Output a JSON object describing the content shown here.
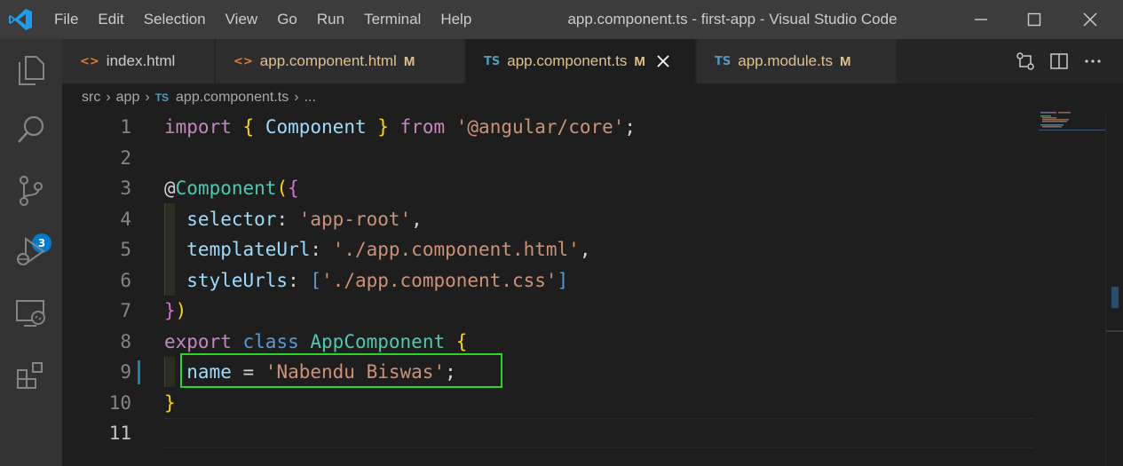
{
  "titlebar": {
    "menu": [
      "File",
      "Edit",
      "Selection",
      "View",
      "Go",
      "Run",
      "Terminal",
      "Help"
    ],
    "window_title": "app.component.ts - first-app - Visual Studio Code"
  },
  "activity_bar": {
    "items": [
      "explorer-icon",
      "search-icon",
      "source-control-icon",
      "run-debug-icon",
      "remote-explorer-icon",
      "extensions-icon"
    ],
    "source_control_badge": "3"
  },
  "tabs": [
    {
      "icon": "<>",
      "label": "index.html",
      "modified": "",
      "active": false
    },
    {
      "icon": "<>",
      "label": "app.component.html",
      "modified": "M",
      "active": false
    },
    {
      "icon": "TS",
      "label": "app.component.ts",
      "modified": "M",
      "active": true
    },
    {
      "icon": "TS",
      "label": "app.module.ts",
      "modified": "M",
      "active": false
    }
  ],
  "breadcrumb": {
    "segments": [
      "src",
      "app"
    ],
    "file_icon": "TS",
    "file": "app.component.ts",
    "tail": "..."
  },
  "editor": {
    "line_numbers": [
      "1",
      "2",
      "3",
      "4",
      "5",
      "6",
      "7",
      "8",
      "9",
      "10",
      "11"
    ],
    "current_line": 11,
    "highlighted_line": 9,
    "lines": [
      [
        {
          "t": "import",
          "c": "kw-purple"
        },
        {
          "t": " ",
          "c": "plain"
        },
        {
          "t": "{",
          "c": "brace-y"
        },
        {
          "t": " Component ",
          "c": "var"
        },
        {
          "t": "}",
          "c": "brace-y"
        },
        {
          "t": " from ",
          "c": "kw-purple"
        },
        {
          "t": "'@angular/core'",
          "c": "str"
        },
        {
          "t": ";",
          "c": "plain"
        }
      ],
      [],
      [
        {
          "t": "@",
          "c": "plain"
        },
        {
          "t": "Component",
          "c": "cls"
        },
        {
          "t": "(",
          "c": "brace-y"
        },
        {
          "t": "{",
          "c": "brace-p"
        }
      ],
      [
        {
          "t": "  selector",
          "c": "var"
        },
        {
          "t": ": ",
          "c": "plain"
        },
        {
          "t": "'app-root'",
          "c": "str"
        },
        {
          "t": ",",
          "c": "plain"
        }
      ],
      [
        {
          "t": "  templateUrl",
          "c": "var"
        },
        {
          "t": ": ",
          "c": "plain"
        },
        {
          "t": "'./app.component.html'",
          "c": "str"
        },
        {
          "t": ",",
          "c": "plain"
        }
      ],
      [
        {
          "t": "  styleUrls",
          "c": "var"
        },
        {
          "t": ": ",
          "c": "plain"
        },
        {
          "t": "[",
          "c": "kw-blue"
        },
        {
          "t": "'./app.component.css'",
          "c": "str"
        },
        {
          "t": "]",
          "c": "kw-blue"
        }
      ],
      [
        {
          "t": "}",
          "c": "brace-p"
        },
        {
          "t": ")",
          "c": "brace-y"
        }
      ],
      [
        {
          "t": "export",
          "c": "kw-purple"
        },
        {
          "t": " ",
          "c": "plain"
        },
        {
          "t": "class",
          "c": "kw-blue"
        },
        {
          "t": " ",
          "c": "plain"
        },
        {
          "t": "AppComponent",
          "c": "cls"
        },
        {
          "t": " ",
          "c": "plain"
        },
        {
          "t": "{",
          "c": "brace-y"
        }
      ],
      [
        {
          "t": "  name",
          "c": "var"
        },
        {
          "t": " = ",
          "c": "plain"
        },
        {
          "t": "'Nabendu Biswas'",
          "c": "str"
        },
        {
          "t": ";",
          "c": "plain"
        }
      ],
      [
        {
          "t": "}",
          "c": "brace-y"
        }
      ],
      []
    ]
  },
  "colors": {
    "accent": "#007acc",
    "highlight_box": "#2ad52a",
    "modified_label": "#e2c08d",
    "ts_icon": "#519aba",
    "html_icon": "#e37933"
  }
}
